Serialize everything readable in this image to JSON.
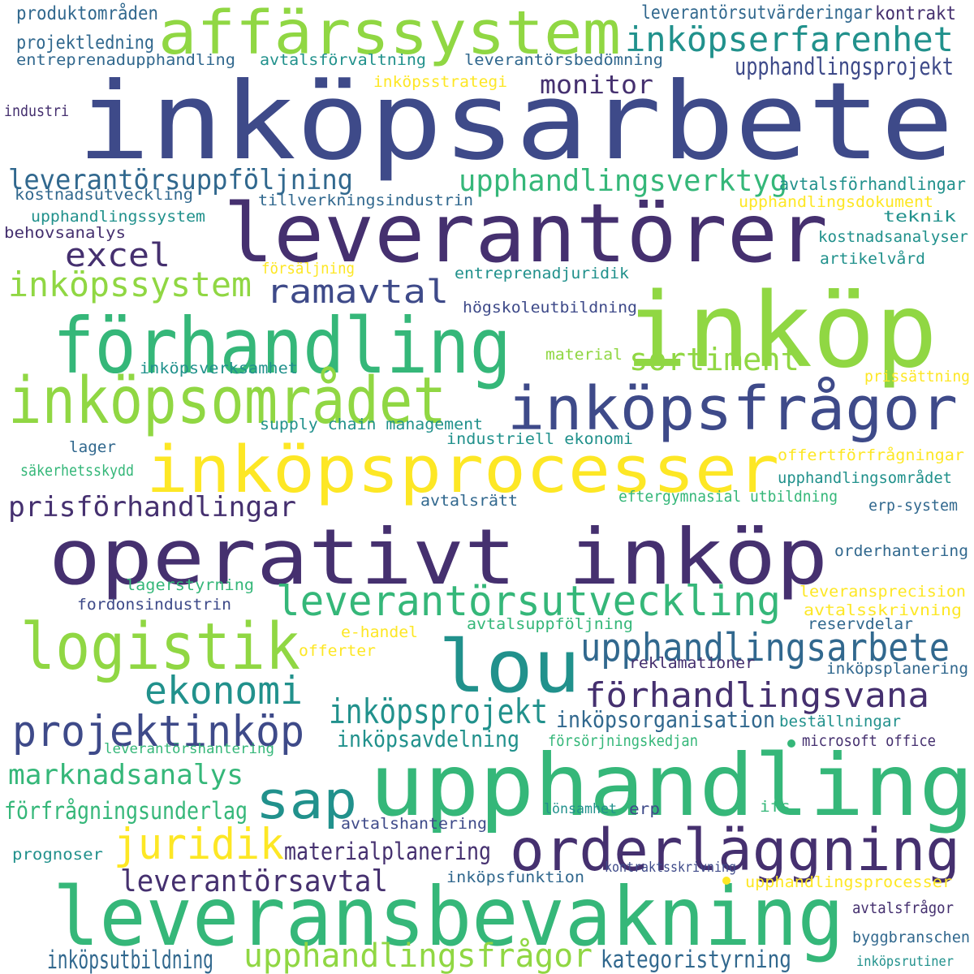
{
  "palette": {
    "background": "#ffffff",
    "viridis_purple": "#45306f",
    "viridis_indigo": "#3e4a89",
    "viridis_blue": "#31688e",
    "viridis_teal": "#21918c",
    "viridis_green": "#35b779",
    "viridis_lime": "#90d743",
    "viridis_yellow": "#fde725"
  },
  "words": [
    "inköpsarbete",
    "leverantörer",
    "inköp",
    "affärssystem",
    "inköpserfarenhet",
    "förhandling",
    "inköpsområdet",
    "inköpsfrågor",
    "inköpsprocesser",
    "operativt inköp",
    "upphandling",
    "leveransbevakning",
    "lou",
    "logistik",
    "orderläggning",
    "leverantörsutveckling",
    "upphandlingsarbete",
    "förhandlingsvana",
    "ekonomi",
    "projektinköp",
    "sap",
    "juridik",
    "inköpsprojekt",
    "inköpssystem",
    "ramavtal",
    "excel",
    "monitor",
    "upphandlingsprojekt",
    "upphandlingsverktyg",
    "leverantörsuppföljning",
    "sortiment",
    "prisförhandlingar",
    "marknadsanalys",
    "förfrågningsunderlag",
    "leverantörsavtal",
    "materialplanering",
    "upphandlingsfrågor",
    "inköpsutbildning",
    "kategoristyrning",
    "inköpsorganisation",
    "inköpsavdelning",
    "produktområden",
    "leverantörsutvärderingar",
    "kontrakt",
    "projektledning",
    "entreprenadupphandling",
    "avtalsförvaltning",
    "leverantörsbedömning",
    "inköpsstrategi",
    "industri",
    "avtalsförhandlingar",
    "kostnadsutveckling",
    "tillverkningsindustrin",
    "upphandlingsdokument",
    "upphandlingssystem",
    "teknik",
    "behovsanalys",
    "kostnadsanalyser",
    "artikelvård",
    "försäljning",
    "entreprenadjuridik",
    "högskoleutbildning",
    "material",
    "inköpsverksamhet",
    "prissättning",
    "supply chain management",
    "industriell ekonomi",
    "lager",
    "offertförfrågningar",
    "säkerhetsskydd",
    "upphandlingsområdet",
    "avtalsrätt",
    "eftergymnasial utbildning",
    "erp-system",
    "orderhantering",
    "lagerstyrning",
    "leveransprecision",
    "fordonsindustrin",
    "avtalsskrivning",
    "e-handel",
    "avtalsuppföljning",
    "reservdelar",
    "offerter",
    "reklamationer",
    "inköpsplanering",
    "beställningar",
    "försörjningskedjan",
    "leverantörshantering",
    "microsoft office",
    "lönsamhet",
    "erp",
    "ifs",
    "avtalshantering",
    "prognoser",
    "inköpsfunktion",
    "kontraktsskrivning",
    "upphandlingsprocesser",
    "avtalsfrågor",
    "byggbranschen",
    "inköpsrutiner"
  ]
}
